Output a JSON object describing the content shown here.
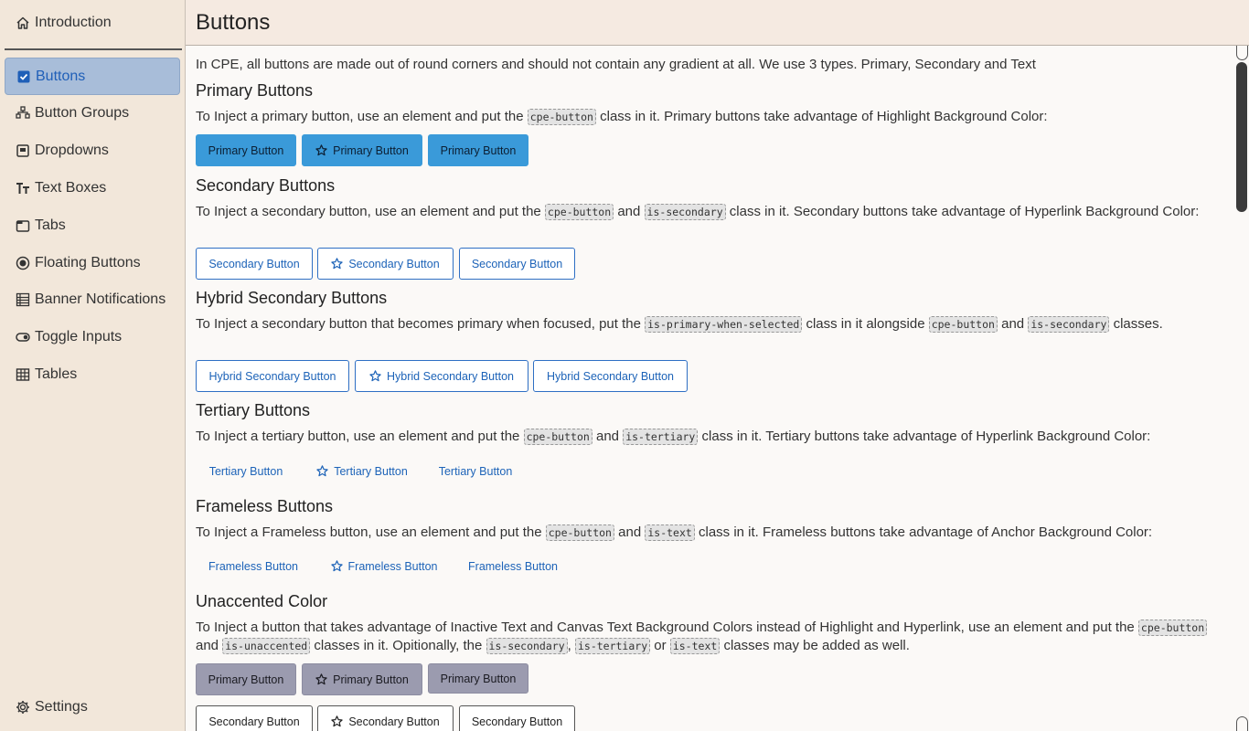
{
  "sidebar": {
    "items": [
      {
        "label": "Introduction",
        "icon": "home-icon"
      },
      {
        "label": "Buttons",
        "icon": "checkbox-icon",
        "active": true
      },
      {
        "label": "Button Groups",
        "icon": "nodes-icon"
      },
      {
        "label": "Dropdowns",
        "icon": "dropdown-icon"
      },
      {
        "label": "Text Boxes",
        "icon": "text-icon"
      },
      {
        "label": "Tabs",
        "icon": "tab-icon"
      },
      {
        "label": "Floating Buttons",
        "icon": "radio-icon"
      },
      {
        "label": "Banner Notifications",
        "icon": "list-icon"
      },
      {
        "label": "Toggle Inputs",
        "icon": "toggle-icon"
      },
      {
        "label": "Tables",
        "icon": "table-icon"
      }
    ],
    "settings_label": "Settings"
  },
  "header": {
    "title": "Buttons"
  },
  "intro": "In CPE, all buttons are made out of round corners and should not contain any gradient at all. We use 3 types. Primary, Secondary and Text",
  "primary": {
    "title": "Primary Buttons",
    "desc_a": "To Inject a primary button, use an element and put the ",
    "code1": "cpe-button",
    "desc_b": " class in it. Primary buttons take advantage of Highlight Background Color:",
    "buttons": [
      "Primary Button",
      "Primary Button",
      "Primary Button"
    ]
  },
  "secondary": {
    "title": "Secondary Buttons",
    "desc_a": "To Inject a secondary button, use an element and put the ",
    "code1": "cpe-button",
    "desc_b": " and ",
    "code2": "is-secondary",
    "desc_c": " class in it. Secondary buttons take advantage of Hyperlink Background Color:",
    "buttons": [
      "Secondary Button",
      "Secondary Button",
      "Secondary Button"
    ]
  },
  "hybrid": {
    "title": "Hybrid Secondary Buttons",
    "desc_a": "To Inject a secondary button that becomes primary when focused, put the ",
    "code1": "is-primary-when-selected",
    "desc_b": " class in it alongside ",
    "code2": "cpe-button",
    "desc_c": " and ",
    "code3": "is-secondary",
    "desc_d": " classes.",
    "buttons": [
      "Hybrid Secondary Button",
      "Hybrid Secondary Button",
      "Hybrid Secondary Button"
    ]
  },
  "tertiary": {
    "title": "Tertiary Buttons",
    "desc_a": "To Inject a tertiary button, use an element and put the ",
    "code1": "cpe-button",
    "desc_b": " and ",
    "code2": "is-tertiary",
    "desc_c": " class in it. Tertiary buttons take advantage of Hyperlink Background Color:",
    "buttons": [
      "Tertiary Button",
      "Tertiary Button",
      "Tertiary Button"
    ]
  },
  "frameless": {
    "title": "Frameless Buttons",
    "desc_a": "To Inject a Frameless button, use an element and put the ",
    "code1": "cpe-button",
    "desc_b": " and ",
    "code2": "is-text",
    "desc_c": " class in it. Frameless buttons take advantage of Anchor Background Color:",
    "buttons": [
      "Frameless Button",
      "Frameless Button",
      "Frameless Button"
    ]
  },
  "unaccented": {
    "title": "Unaccented Color",
    "desc_a": "To Inject a button that takes advantage of Inactive Text and Canvas Text Background Colors instead of Highlight and Hyperlink, use an element and put the ",
    "code1": "cpe-button",
    "desc_b": " and ",
    "code2": "is-unaccented",
    "desc_c": " classes in it. Opitionally, the ",
    "code3": "is-secondary",
    "desc_d": ", ",
    "code4": "is-tertiary",
    "desc_e": " or ",
    "code5": "is-text",
    "desc_f": " classes may be added as well.",
    "primary_buttons": [
      "Primary Button",
      "Primary Button",
      "Primary Button"
    ],
    "secondary_buttons": [
      "Secondary Button",
      "Secondary Button",
      "Secondary Button"
    ]
  },
  "colors": {
    "primary": "#3a9ad9",
    "hyperlink": "#1d63b8",
    "unaccented": "#9b9baf",
    "sidebar_bg": "#f2e7da",
    "active_item": "#a8bdd9"
  }
}
